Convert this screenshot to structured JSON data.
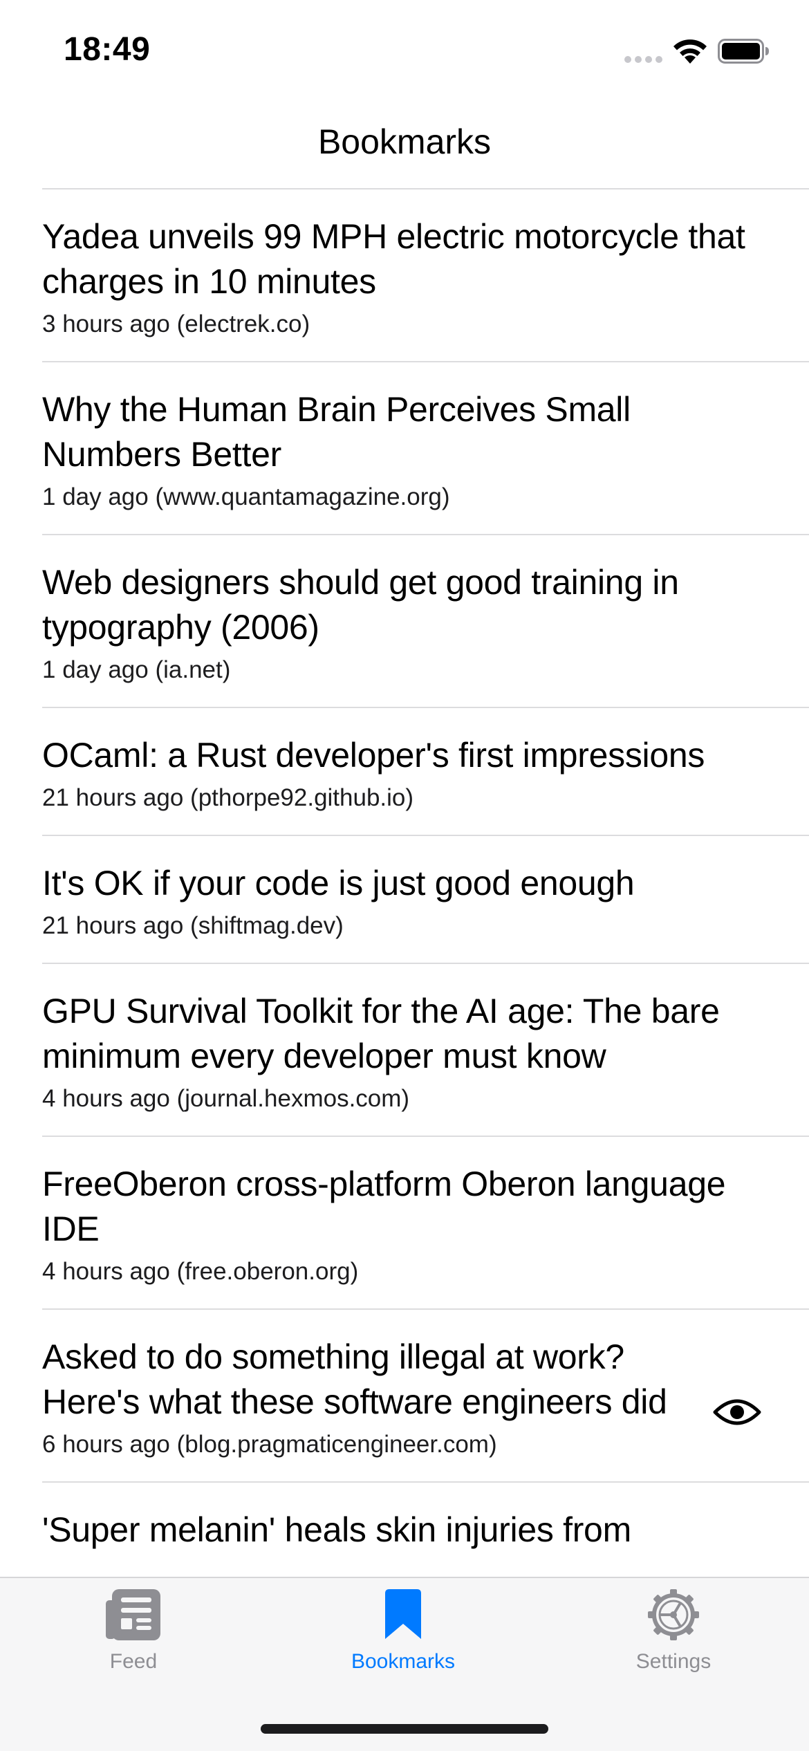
{
  "status_bar": {
    "time": "18:49"
  },
  "nav": {
    "title": "Bookmarks"
  },
  "bookmarks": [
    {
      "title": "Yadea unveils 99 MPH electric motorcycle that charges in 10 minutes",
      "meta": "3 hours ago (electrek.co)"
    },
    {
      "title": "Why the Human Brain Perceives Small Numbers Better",
      "meta": "1 day ago (www.quantamagazine.org)"
    },
    {
      "title": "Web designers should get good training in typography (2006)",
      "meta": "1 day ago (ia.net)"
    },
    {
      "title": "OCaml: a Rust developer's first impressions",
      "meta": "21 hours ago (pthorpe92.github.io)"
    },
    {
      "title": "It's OK if your code is just good enough",
      "meta": "21 hours ago (shiftmag.dev)"
    },
    {
      "title": "GPU Survival Toolkit for the AI age: The bare minimum every developer must know",
      "meta": "4 hours ago (journal.hexmos.com)"
    },
    {
      "title": "FreeOberon cross-platform Oberon language IDE",
      "meta": "4 hours ago (free.oberon.org)"
    },
    {
      "title": "Asked to do something illegal at work? Here's what these software engineers did",
      "meta": "6 hours ago (blog.pragmaticengineer.com)",
      "icon": "eye-icon"
    },
    {
      "title": "'Super melanin' heals skin injuries from",
      "meta": ""
    }
  ],
  "tab_bar": {
    "tabs": [
      {
        "label": "Feed",
        "icon": "newspaper-icon"
      },
      {
        "label": "Bookmarks",
        "icon": "bookmark-icon",
        "selected": true
      },
      {
        "label": "Settings",
        "icon": "gear-icon"
      }
    ],
    "active_color": "#007aff",
    "inactive_color": "#8e8e93"
  }
}
